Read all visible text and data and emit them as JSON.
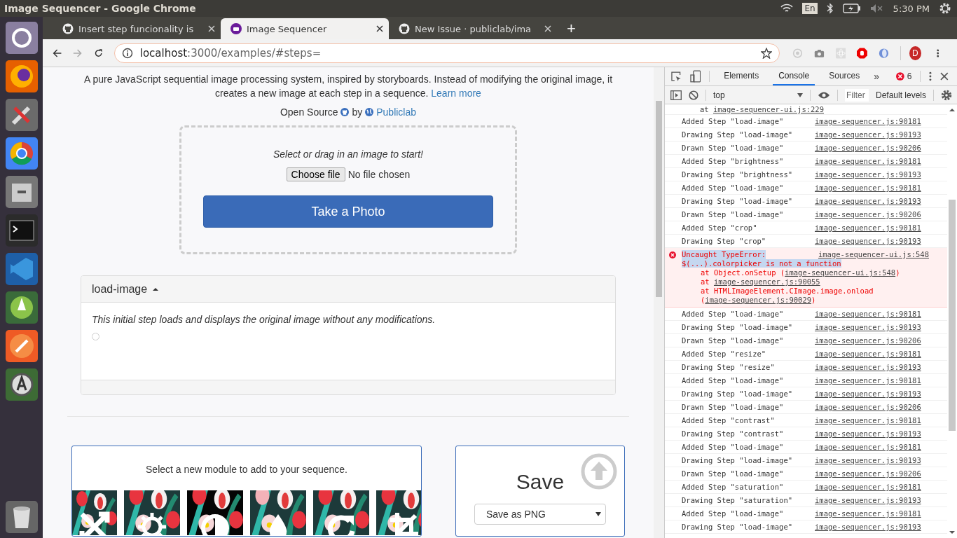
{
  "top_bar": {
    "title": "Image Sequencer - Google Chrome",
    "keyboard": "En",
    "time": "5:30 PM"
  },
  "tabs": [
    {
      "title": "Insert step funcionality is",
      "selected": false
    },
    {
      "title": "Image Sequencer",
      "selected": true
    },
    {
      "title": "New Issue · publiclab/ima",
      "selected": false
    }
  ],
  "new_tab": "+",
  "address": {
    "host": "localhost",
    "path": ":3000/examples/#steps="
  },
  "profile": "D",
  "page": {
    "intro": "A pure JavaScript sequential image processing system, inspired by storyboards. Instead of modifying the original image, it creates a new image at each step in a sequence.",
    "learn_more": "Learn more",
    "open_source": "Open Source",
    "by": "by",
    "publiclab": "Publiclab",
    "dropzone": {
      "prompt": "Select or drag in an image to start!",
      "choose_file": "Choose file",
      "no_file": "No file chosen",
      "take_photo": "Take a Photo"
    },
    "step": {
      "title": "load-image",
      "expanded": true,
      "description": "This initial step loads and displays the original image without any modifications.",
      "option_selected": false
    },
    "modules": {
      "prompt": "Select a new module to add to your sequence.",
      "items": [
        {
          "kind": "resize"
        },
        {
          "kind": "brightness"
        },
        {
          "kind": "contrast"
        },
        {
          "kind": "saturation"
        },
        {
          "kind": "rotate"
        },
        {
          "kind": "crop"
        }
      ]
    },
    "save": {
      "title": "Save",
      "format": "Save as PNG"
    }
  },
  "devtools": {
    "tabs": [
      {
        "label": "Elements",
        "selected": false
      },
      {
        "label": "Console",
        "selected": true
      },
      {
        "label": "Sources",
        "selected": false
      }
    ],
    "more": "»",
    "error_count": "6",
    "context": "top",
    "filter_placeholder": "Filter",
    "levels": "Default levels",
    "messages": [
      {
        "kind": "trace",
        "text": "at ",
        "source": "image-sequencer-ui.js:229"
      },
      {
        "kind": "log",
        "text": "Added Step \"load-image\"",
        "source": "image-sequencer.js:90181"
      },
      {
        "kind": "log",
        "text": "Drawing Step \"load-image\"",
        "source": "image-sequencer.js:90193"
      },
      {
        "kind": "log",
        "text": "Drawn Step \"load-image\"",
        "source": "image-sequencer.js:90206"
      },
      {
        "kind": "log",
        "text": "Added Step \"brightness\"",
        "source": "image-sequencer.js:90181"
      },
      {
        "kind": "log",
        "text": "Drawing Step \"brightness\"",
        "source": "image-sequencer.js:90193"
      },
      {
        "kind": "log",
        "text": "Added Step \"load-image\"",
        "source": "image-sequencer.js:90181"
      },
      {
        "kind": "log",
        "text": "Drawing Step \"load-image\"",
        "source": "image-sequencer.js:90193"
      },
      {
        "kind": "log",
        "text": "Drawn Step \"load-image\"",
        "source": "image-sequencer.js:90206"
      },
      {
        "kind": "log",
        "text": "Added Step \"crop\"",
        "source": "image-sequencer.js:90181"
      },
      {
        "kind": "log",
        "text": "Drawing Step \"crop\"",
        "source": "image-sequencer.js:90193"
      },
      {
        "kind": "error",
        "text": "Uncaught TypeError:",
        "selected_text": "$(...).colorpicker is not a function",
        "source": "image-sequencer-ui.js:548",
        "stack": [
          {
            "before": "at Object.onSetup (",
            "link": "image-sequencer-ui.js:548",
            "after": ")"
          },
          {
            "before": "at ",
            "link": "image-sequencer.js:90055"
          },
          {
            "before": "at HTMLImageElement.CImage.image.onload (",
            "link": "image-sequencer.js:90029",
            "after": ")"
          }
        ]
      },
      {
        "kind": "log",
        "text": "Added Step \"load-image\"",
        "source": "image-sequencer.js:90181"
      },
      {
        "kind": "log",
        "text": "Drawing Step \"load-image\"",
        "source": "image-sequencer.js:90193"
      },
      {
        "kind": "log",
        "text": "Drawn Step \"load-image\"",
        "source": "image-sequencer.js:90206"
      },
      {
        "kind": "log",
        "text": "Added Step \"resize\"",
        "source": "image-sequencer.js:90181"
      },
      {
        "kind": "log",
        "text": "Drawing Step \"resize\"",
        "source": "image-sequencer.js:90193"
      },
      {
        "kind": "log",
        "text": "Added Step \"load-image\"",
        "source": "image-sequencer.js:90181"
      },
      {
        "kind": "log",
        "text": "Drawing Step \"load-image\"",
        "source": "image-sequencer.js:90193"
      },
      {
        "kind": "log",
        "text": "Drawn Step \"load-image\"",
        "source": "image-sequencer.js:90206"
      },
      {
        "kind": "log",
        "text": "Added Step \"contrast\"",
        "source": "image-sequencer.js:90181"
      },
      {
        "kind": "log",
        "text": "Drawing Step \"contrast\"",
        "source": "image-sequencer.js:90193"
      },
      {
        "kind": "log",
        "text": "Added Step \"load-image\"",
        "source": "image-sequencer.js:90181"
      },
      {
        "kind": "log",
        "text": "Drawing Step \"load-image\"",
        "source": "image-sequencer.js:90193"
      },
      {
        "kind": "log",
        "text": "Drawn Step \"load-image\"",
        "source": "image-sequencer.js:90206"
      },
      {
        "kind": "log",
        "text": "Added Step \"saturation\"",
        "source": "image-sequencer.js:90181"
      },
      {
        "kind": "log",
        "text": "Drawing Step \"saturation\"",
        "source": "image-sequencer.js:90193"
      },
      {
        "kind": "log",
        "text": "Added Step \"load-image\"",
        "source": "image-sequencer.js:90181"
      },
      {
        "kind": "log",
        "text": "Drawing Step \"load-image\"",
        "source": "image-sequencer.js:90193"
      }
    ]
  }
}
